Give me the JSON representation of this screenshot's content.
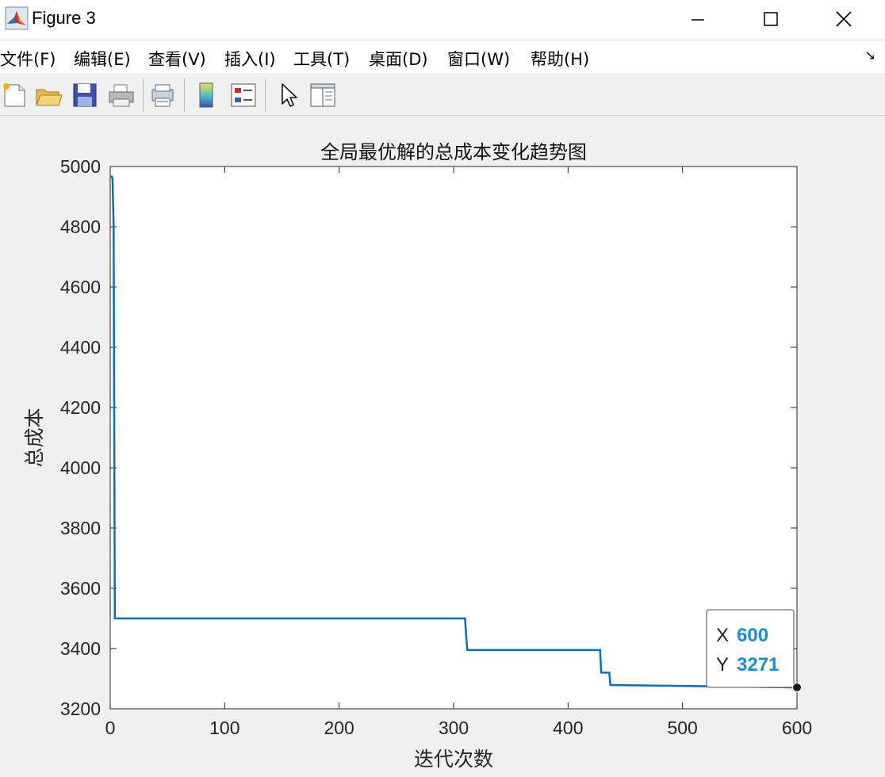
{
  "window": {
    "title": "Figure 3"
  },
  "menu": [
    "文件(F)",
    "编辑(E)",
    "查看(V)",
    "插入(I)",
    "工具(T)",
    "桌面(D)",
    "窗口(W)",
    "帮助(H)"
  ],
  "toolbar": {
    "icons": [
      "new-figure-icon",
      "open-file-icon",
      "save-icon",
      "print-icon",
      "print-preview-icon",
      "colorbar-icon",
      "legend-icon",
      "pointer-icon",
      "property-inspector-icon"
    ]
  },
  "datatip": {
    "x_label": "X",
    "x_value": "600",
    "y_label": "Y",
    "y_value": "3271"
  },
  "colors": {
    "line": "#0072BD",
    "datatip_value": "#1a8fd8"
  },
  "chart_data": {
    "type": "line",
    "title": "全局最优解的总成本变化趋势图",
    "xlabel": "迭代次数",
    "ylabel": "总成本",
    "xlim": [
      0,
      600
    ],
    "ylim": [
      3200,
      5000
    ],
    "xticks": [
      0,
      100,
      200,
      300,
      400,
      500,
      600
    ],
    "yticks": [
      3200,
      3400,
      3600,
      3800,
      4000,
      4200,
      4400,
      4600,
      4800,
      5000
    ],
    "grid": false,
    "series": [
      {
        "x": [
          1,
          2,
          3,
          4,
          5,
          310,
          311,
          312,
          428,
          429,
          430,
          436,
          437,
          600
        ],
        "y": [
          4970,
          4960,
          4800,
          3500,
          3500,
          3500,
          3440,
          3395,
          3395,
          3320,
          3320,
          3320,
          3279,
          3271
        ]
      }
    ]
  }
}
